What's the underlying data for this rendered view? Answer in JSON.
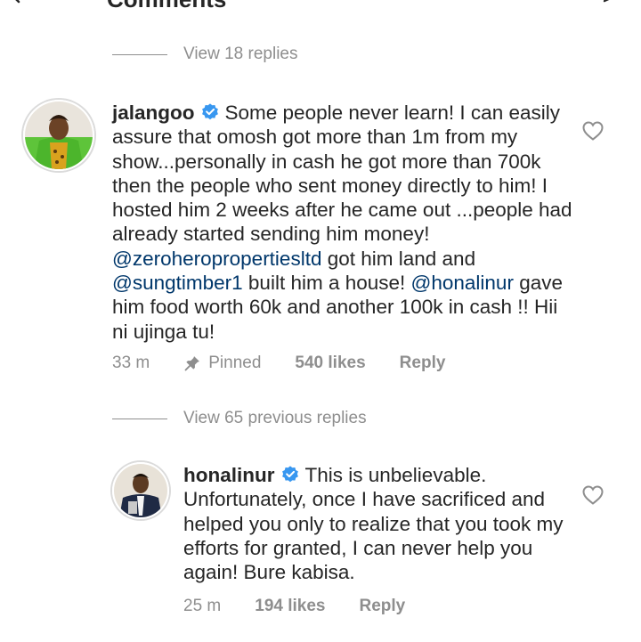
{
  "top": {
    "title": "Comments"
  },
  "thread1": {
    "view_replies": "View 18 replies"
  },
  "comment1": {
    "username": "jalangoo",
    "text_1": "Some people never learn! I can easily assure that omosh got more than 1m from my show...personally in cash he got more than 700k then the people who sent money directly to him!  I hosted him 2 weeks after he came out ...people had already started sending him money! ",
    "mention_1": "@zeroheropropertiesltd",
    "text_2": " got him land  and ",
    "mention_2": "@sungtimber1",
    "text_3": " built him a house! ",
    "mention_3": "@honalinur",
    "text_4": " gave him food worth 60k and another 100k in cash !! Hii ni ujinga tu!",
    "time": "33 m",
    "pinned": "Pinned",
    "likes": "540 likes",
    "reply": "Reply"
  },
  "thread2": {
    "view_replies": "View 65 previous replies"
  },
  "comment2": {
    "username": "honalinur",
    "text": "This is unbelievable. Unfortunately, once I have sacrificed and helped you only to realize that you took my efforts for granted, I can never help you again! Bure kabisa.",
    "time": "25 m",
    "likes": "194 likes",
    "reply": "Reply"
  },
  "colors": {
    "text": "#262626",
    "secondary": "#8e8e8e",
    "mention": "#00376b",
    "verified": "#3897f0"
  },
  "icons": [
    "back-arrow-icon",
    "send-icon",
    "verified-icon",
    "pin-icon",
    "heart-icon"
  ]
}
